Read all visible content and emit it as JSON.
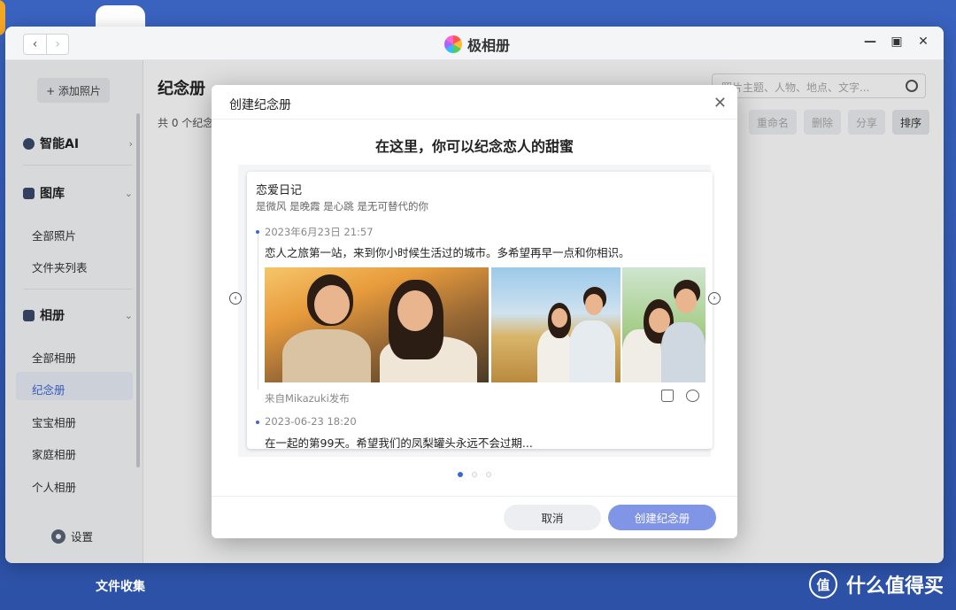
{
  "window": {
    "title": "极相册"
  },
  "sidebar": {
    "add_photo": "+ 添加照片",
    "section_ai": "智能AI",
    "section_library": "图库",
    "library_items": [
      "全部照片",
      "文件夹列表"
    ],
    "section_albums": "相册",
    "album_items": [
      "全部相册",
      "纪念册",
      "宝宝相册",
      "家庭相册",
      "个人相册"
    ],
    "active_item": "纪念册",
    "settings": "设置"
  },
  "main": {
    "title": "纪念册",
    "subtitle": "共 0 个纪念",
    "search_placeholder": "照片主题、人物、地点、文字...",
    "toolbar": [
      "重命名",
      "删除",
      "分享",
      "排序"
    ]
  },
  "dialog": {
    "title": "创建纪念册",
    "heading": "在这里，你可以纪念恋人的甜蜜",
    "card": {
      "title": "恋爱日记",
      "subtitle": "是微风 是晚霞 是心跳 是无可替代的你",
      "entry1_date": "2023年6月23日 21:57",
      "entry1_text": "恋人之旅第一站，来到你小时候生活过的城市。多希望再早一点和你相识。",
      "entry1_footer": "来自Mikazuki发布",
      "entry2_date": "2023-06-23 18:20",
      "entry2_text": "在一起的第99天。希望我们的凤梨罐头永远不会过期..."
    },
    "page_count": 3,
    "active_page": 1,
    "cancel": "取消",
    "create": "创建纪念册"
  },
  "desktop": {
    "taskbar_label": "文件收集",
    "watermark_logo": "值",
    "watermark_text": "什么值得买"
  },
  "colors": {
    "accent": "#3b67d6",
    "create_button": "#8195e6",
    "desktop": "#2f57b0"
  }
}
